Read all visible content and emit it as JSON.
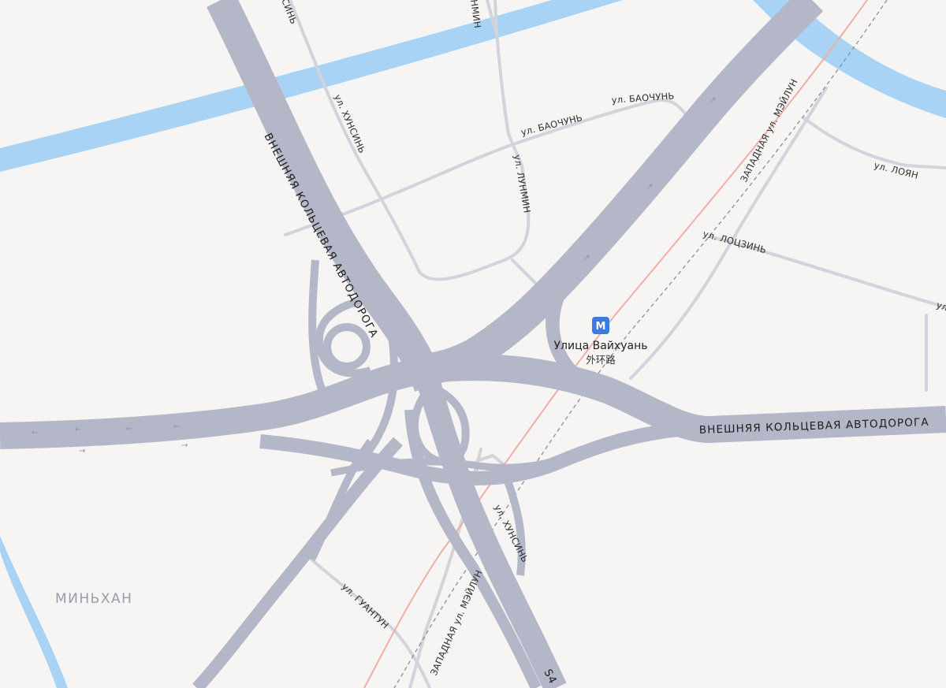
{
  "map": {
    "highway_label_west": "ВНЕШНЯЯ КОЛЬЦЕВАЯ АВТОДОРОГА",
    "highway_label_east": "ВНЕШНЯЯ КОЛЬЦЕВАЯ АВТОДОРОГА",
    "highway_shield": "S4",
    "district": "МИНЬХАН",
    "streets": {
      "hunsin_north": "ул. ХУНСИНЬ",
      "hunsin_north_top": "СИНЬ",
      "lunmin_top": "НМИН",
      "lunmin": "ул. ЛУНМИН",
      "baochun_1": "ул. БАОЧУНЬ",
      "baochun_2": "ул. БАОЧУНЬ",
      "loyan": "ул. ЛОЯН",
      "lotszin": "ул. ЛОЦЗИНЬ",
      "lotszin_cut": "ул",
      "meilun_west_north": "ЗАПАДНАЯ ул. МЭЙЛУН",
      "meilun_west_south": "ЗАПАДНАЯ ул. МЭЙЛУН",
      "guantun": "ул. ГУАНТУН",
      "hunsin_south": "ул. ХУНСИНЬ"
    },
    "metro": {
      "icon_letter": "М",
      "name": "Улица Вайхуань",
      "name_native": "外环路",
      "icon_color": "#3d7be0"
    },
    "colors": {
      "background": "#f6f5f3",
      "water": "#a8d3f5",
      "highway": "#b3b7c7",
      "street": "#d2d3dd",
      "railway": "#f0aea5",
      "metro_track": "#8a8f9c"
    }
  }
}
